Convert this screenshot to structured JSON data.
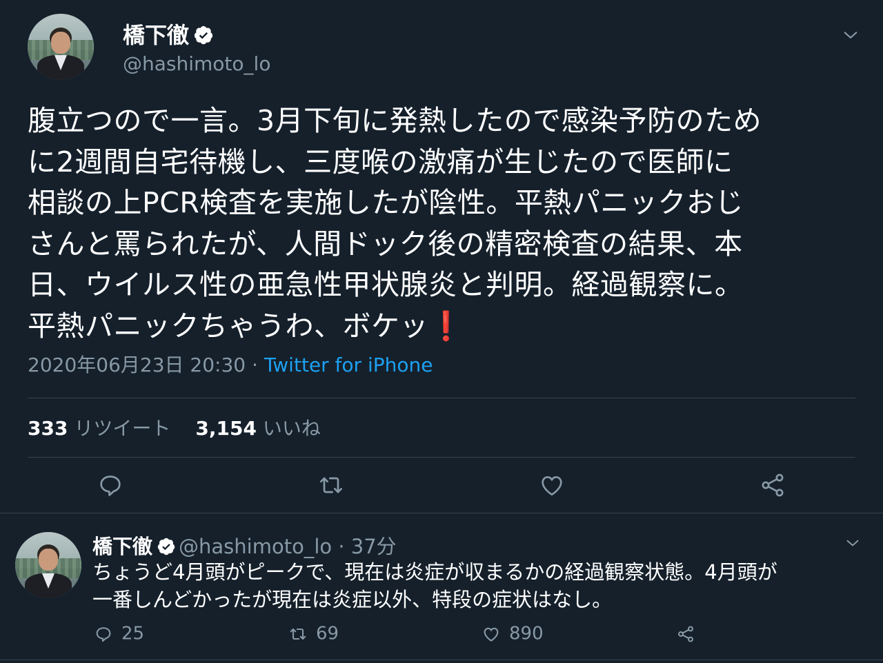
{
  "main_tweet": {
    "display_name": "橋下徹",
    "handle": "@hashimoto_lo",
    "text_lines": [
      "腹立つので一言。3月下旬に発熱したので感染予防のため",
      "に2週間自宅待機し、三度喉の激痛が生じたので医師に",
      "相談の上PCR検査を実施したが陰性。平熱パニックおじ",
      "さんと罵られたが、人間ドック後の精密検査の結果、本",
      "日、ウイルス性の亜急性甲状腺炎と判明。経過観察に。",
      "平熱パニックちゃうわ、ボケッ"
    ],
    "emoji": "❗",
    "timestamp": "2020年06月23日 20:30",
    "separator": " · ",
    "source": "Twitter for iPhone",
    "retweet_count": "333",
    "retweet_label": "リツイート",
    "like_count": "3,154",
    "like_label": "いいね"
  },
  "reply": {
    "display_name": "橋下徹",
    "handle": "@hashimoto_lo",
    "time_ago": "· 37分",
    "text_lines": [
      "ちょうど4月頭がピークで、現在は炎症が収まるかの経過観察状態。4月頭が",
      "一番しんどかったが現在は炎症以外、特段の症状はなし。"
    ],
    "reply_count": "25",
    "retweet_count": "69",
    "like_count": "890"
  },
  "icons": {
    "verified": "verified-badge-icon",
    "caret": "chevron-down-icon",
    "reply": "speech-bubble-icon",
    "retweet": "retweet-arrows-icon",
    "like": "heart-icon",
    "share": "share-icon"
  },
  "colors": {
    "background": "#15202b",
    "text": "#ffffff",
    "muted": "#8899a6",
    "link": "#1da1f2",
    "divider": "#38444d",
    "exclaim": "#e0245e"
  }
}
